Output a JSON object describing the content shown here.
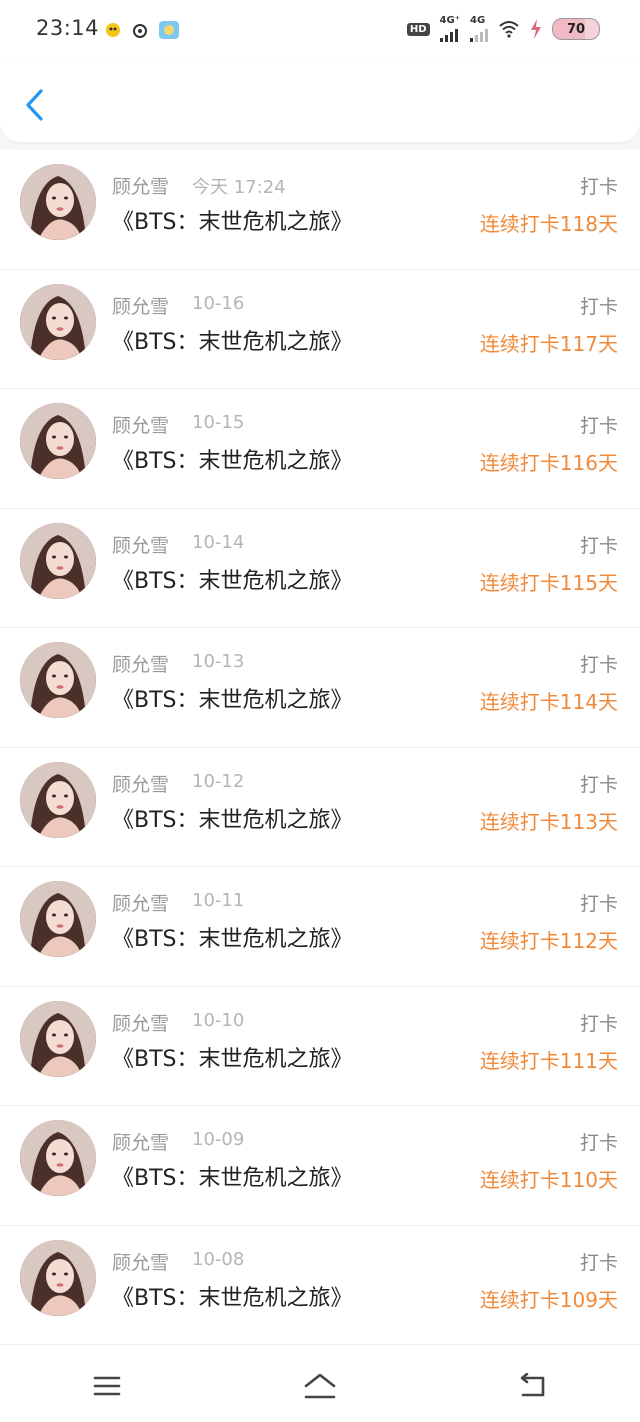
{
  "status_bar": {
    "time": "23:14",
    "hd_label": "HD",
    "net1": "4G⁺",
    "net2": "4G",
    "battery": 70,
    "battery_text": "70"
  },
  "header": {
    "back_icon": "chevron-left-icon",
    "accent_color": "#2196f3"
  },
  "colors": {
    "streak": "#f08a3b",
    "meta": "#9a9a9a"
  },
  "records": [
    {
      "name": "顾允雪",
      "date": "今天 17:24",
      "title": "《BTS：末世危机之旅》",
      "action": "打卡",
      "streak": "连续打卡118天"
    },
    {
      "name": "顾允雪",
      "date": "10-16",
      "title": "《BTS：末世危机之旅》",
      "action": "打卡",
      "streak": "连续打卡117天"
    },
    {
      "name": "顾允雪",
      "date": "10-15",
      "title": "《BTS：末世危机之旅》",
      "action": "打卡",
      "streak": "连续打卡116天"
    },
    {
      "name": "顾允雪",
      "date": "10-14",
      "title": "《BTS：末世危机之旅》",
      "action": "打卡",
      "streak": "连续打卡115天"
    },
    {
      "name": "顾允雪",
      "date": "10-13",
      "title": "《BTS：末世危机之旅》",
      "action": "打卡",
      "streak": "连续打卡114天"
    },
    {
      "name": "顾允雪",
      "date": "10-12",
      "title": "《BTS：末世危机之旅》",
      "action": "打卡",
      "streak": "连续打卡113天"
    },
    {
      "name": "顾允雪",
      "date": "10-11",
      "title": "《BTS：末世危机之旅》",
      "action": "打卡",
      "streak": "连续打卡112天"
    },
    {
      "name": "顾允雪",
      "date": "10-10",
      "title": "《BTS：末世危机之旅》",
      "action": "打卡",
      "streak": "连续打卡111天"
    },
    {
      "name": "顾允雪",
      "date": "10-09",
      "title": "《BTS：末世危机之旅》",
      "action": "打卡",
      "streak": "连续打卡110天"
    },
    {
      "name": "顾允雪",
      "date": "10-08",
      "title": "《BTS：末世危机之旅》",
      "action": "打卡",
      "streak": "连续打卡109天"
    }
  ],
  "nav": {
    "menu_icon": "menu-icon",
    "home_icon": "home-icon",
    "back_icon": "back-icon"
  }
}
